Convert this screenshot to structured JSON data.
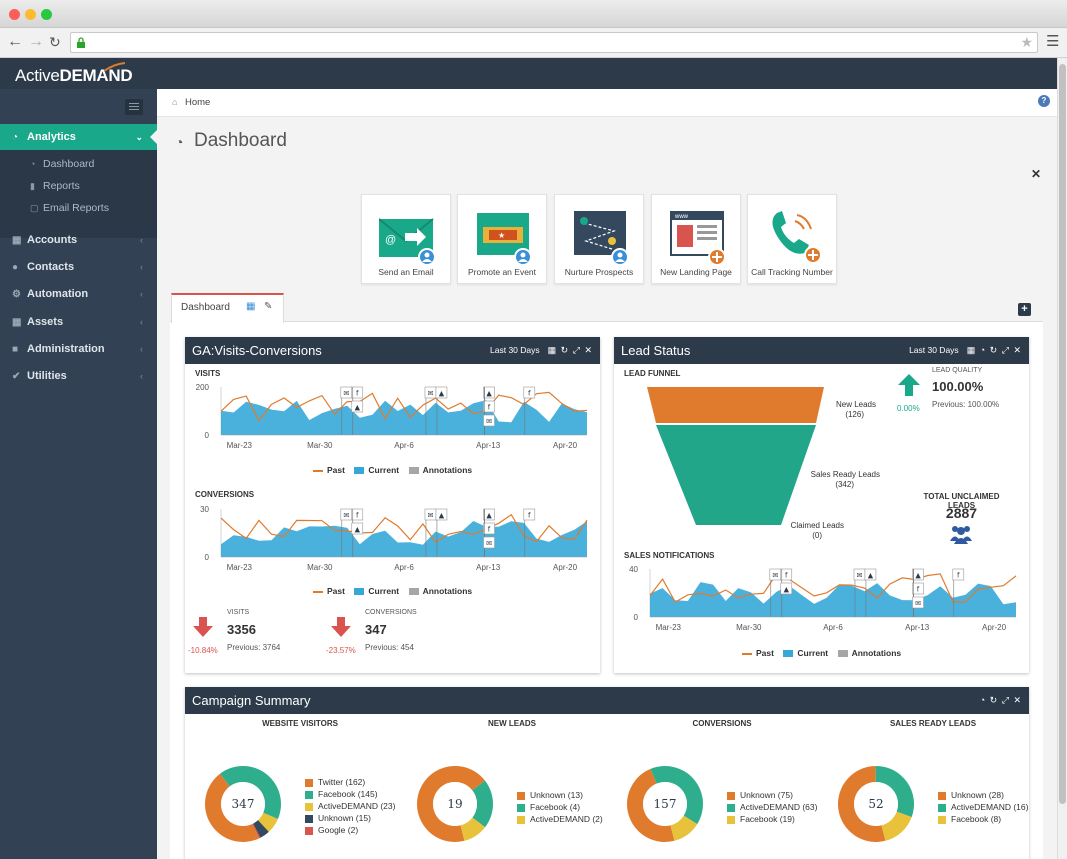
{
  "browser": {
    "url": ""
  },
  "app": {
    "logo_active": "Active",
    "logo_demand": "DEMAND",
    "breadcrumb": "Home",
    "help": "?",
    "page_title": "Dashboard"
  },
  "sidebar": {
    "items": [
      {
        "label": "Analytics",
        "icon": "dashboard-icon",
        "active": true
      },
      {
        "label": "Accounts",
        "icon": "sitemap-icon"
      },
      {
        "label": "Contacts",
        "icon": "users-icon"
      },
      {
        "label": "Automation",
        "icon": "cogs-icon"
      },
      {
        "label": "Assets",
        "icon": "grid-icon"
      },
      {
        "label": "Administration",
        "icon": "lock-icon"
      },
      {
        "label": "Utilities",
        "icon": "wrench-icon"
      }
    ],
    "subitems": [
      {
        "label": "Dashboard"
      },
      {
        "label": "Reports"
      },
      {
        "label": "Email Reports"
      }
    ]
  },
  "actions": [
    {
      "label": "Send an Email"
    },
    {
      "label": "Promote an Event"
    },
    {
      "label": "Nurture Prospects"
    },
    {
      "label": "New Landing Page"
    },
    {
      "label": "Call Tracking Number"
    }
  ],
  "tabs": {
    "dashboard": "Dashboard"
  },
  "ga_panel": {
    "title": "GA:Visits-Conversions",
    "range": "Last 30 Days",
    "visits_label": "VISITS",
    "conversions_label": "CONVERSIONS",
    "legend": {
      "past": "Past",
      "current": "Current",
      "annotations": "Annotations"
    },
    "stats": {
      "visits": {
        "label": "VISITS",
        "value": "3356",
        "change": "-10.84%",
        "previous": "Previous: 3764"
      },
      "conversions": {
        "label": "CONVERSIONS",
        "value": "347",
        "change": "-23.57%",
        "previous": "Previous: 454"
      }
    }
  },
  "lead_panel": {
    "title": "Lead Status",
    "range": "Last 30 Days",
    "funnel_label": "LEAD FUNNEL",
    "funnel": [
      {
        "label": "New Leads",
        "count": "(126)"
      },
      {
        "label": "Sales Ready Leads",
        "count": "(342)"
      },
      {
        "label": "Claimed Leads",
        "count": "(0)"
      }
    ],
    "quality_label": "LEAD QUALITY",
    "quality_value": "100.00%",
    "quality_change": "0.00%",
    "quality_previous": "Previous: 100.00%",
    "unclaimed_label": "TOTAL UNCLAIMED LEADS",
    "unclaimed_value": "2887",
    "notifications_label": "SALES NOTIFICATIONS",
    "legend": {
      "past": "Past",
      "current": "Current",
      "annotations": "Annotations"
    }
  },
  "campaign": {
    "title": "Campaign Summary",
    "donuts": [
      {
        "title": "WEBSITE VISITORS",
        "total": "347",
        "items": [
          {
            "label": "Twitter (162)",
            "color": "#e07b2e"
          },
          {
            "label": "Facebook (145)",
            "color": "#2fae8e"
          },
          {
            "label": "ActiveDEMAND (23)",
            "color": "#e8c23a"
          },
          {
            "label": "Unknown (15)",
            "color": "#34495e"
          },
          {
            "label": "Google (2)",
            "color": "#d9534f"
          }
        ]
      },
      {
        "title": "NEW LEADS",
        "total": "19",
        "items": [
          {
            "label": "Unknown (13)",
            "color": "#e07b2e"
          },
          {
            "label": "Facebook (4)",
            "color": "#2fae8e"
          },
          {
            "label": "ActiveDEMAND (2)",
            "color": "#e8c23a"
          }
        ]
      },
      {
        "title": "CONVERSIONS",
        "total": "157",
        "items": [
          {
            "label": "Unknown (75)",
            "color": "#e07b2e"
          },
          {
            "label": "ActiveDEMAND (63)",
            "color": "#2fae8e"
          },
          {
            "label": "Facebook (19)",
            "color": "#e8c23a"
          }
        ]
      },
      {
        "title": "SALES READY LEADS",
        "total": "52",
        "items": [
          {
            "label": "Unknown (28)",
            "color": "#e07b2e"
          },
          {
            "label": "ActiveDEMAND (16)",
            "color": "#2fae8e"
          },
          {
            "label": "Facebook (8)",
            "color": "#e8c23a"
          }
        ]
      }
    ]
  },
  "chart_axes": {
    "x_ticks": [
      "Mar-23",
      "Mar-30",
      "Apr-6",
      "Apr-13",
      "Apr-20"
    ],
    "visits_y": [
      "200",
      "0"
    ],
    "conversions_y": [
      "30",
      "0"
    ],
    "notifications_y": [
      "40",
      "0"
    ]
  },
  "colors": {
    "accent": "#1aa88a",
    "navy": "#2c3a4a",
    "past": "#e07b2e",
    "current": "#35a8d8",
    "annotation": "#a6a6a6",
    "down": "#d9534f",
    "up": "#1aa88a"
  }
}
